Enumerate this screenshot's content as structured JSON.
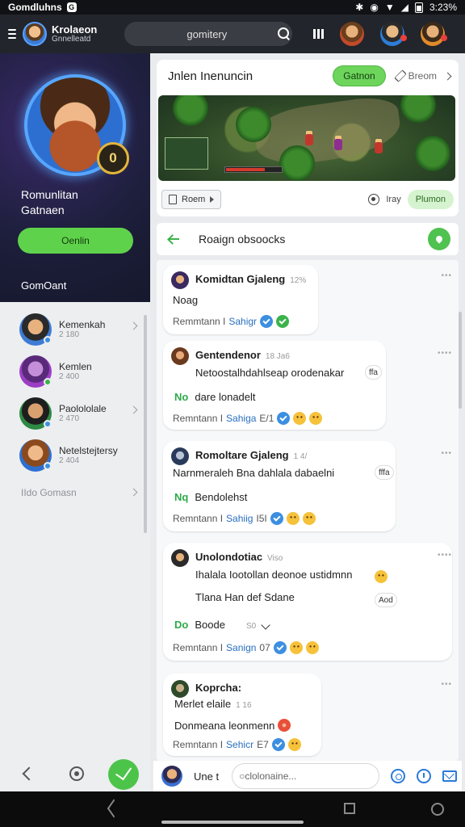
{
  "status_bar": {
    "app_name": "Gomdluhns",
    "g_badge": "G",
    "time": "3:23%"
  },
  "appbar": {
    "title": "Krolaeon",
    "subtitle": "Gnnelleatd",
    "search": {
      "placeholder": "gomitery"
    }
  },
  "drawer": {
    "profile": {
      "level": "0",
      "name_line1": "Romunlitan",
      "name_line2": "Gatnaen"
    },
    "profile_button": "Oenlin",
    "section_title": "GomOant",
    "items": [
      {
        "name": "Kemenkah",
        "sub": "2 180",
        "status_color": "#3c8fe0"
      },
      {
        "name": "Kemlen",
        "sub": "2 400",
        "status_color": "#3bb34a"
      },
      {
        "name": "Paolololale",
        "sub": "2 470",
        "status_color": "#3c8fe0"
      },
      {
        "name": "Netelstejtersy",
        "sub": "2 404",
        "status_color": "#3c8fe0"
      }
    ],
    "more_label": "IIdo Gomasn"
  },
  "game_card": {
    "title": "Jnlen Inenuncin",
    "join_button": "Gatnon",
    "secondary_action": "Breom",
    "chip": "Roem",
    "stat_label": "Iray",
    "action_pill": "Plumon"
  },
  "feed_header": {
    "title": "Roaign obsoocks"
  },
  "messages": [
    {
      "name": "Komidtan Gjaleng",
      "time": "12%",
      "lines": [
        "Noag"
      ],
      "footer_prefix": "Remmtann I",
      "footer_link": "Sahigr",
      "footer_count": ""
    },
    {
      "name": "Gentendenor",
      "time": "18 Ja6",
      "lines": [
        "Netoostalhdahlseap orodenakar"
      ],
      "tag_prefix": "No",
      "tag_text": "dare lonadelt",
      "footer_prefix": "Remntann I",
      "footer_link": "Sahiga",
      "footer_count": "E/1",
      "reaction": "ffa"
    },
    {
      "name": "Romoltare Gjaleng",
      "time": "1 4/",
      "lines": [
        "Narnmeraleh Bna dahlala dabaelni"
      ],
      "tag_prefix": "Nq",
      "tag_text": "Bendolehst",
      "footer_prefix": "Remntann I",
      "footer_link": "Sahiig",
      "footer_count": "I5I",
      "reaction": "fffa"
    },
    {
      "name": "Unolondotiac",
      "time": "Viso",
      "lines": [
        "Ihalala Iootollan deonoe ustidmnn",
        "Tlana Han def Sdane"
      ],
      "tag_prefix": "Do",
      "tag_text": "Boode",
      "tag_extra": "S0",
      "footer_prefix": "Remntann I",
      "footer_link": "Sanign",
      "footer_count": "07",
      "reaction": "Aod"
    },
    {
      "name": "Koprcha:",
      "time": "",
      "lines": [
        "Merlet elaile",
        "Donmeana leonmenn"
      ],
      "line1_time": "1 16",
      "footer_prefix": "Remntann I",
      "footer_link": "Sehicr",
      "footer_count": "E7"
    }
  ],
  "composer": {
    "label": "Une t",
    "placeholder": "clolonaine..."
  }
}
